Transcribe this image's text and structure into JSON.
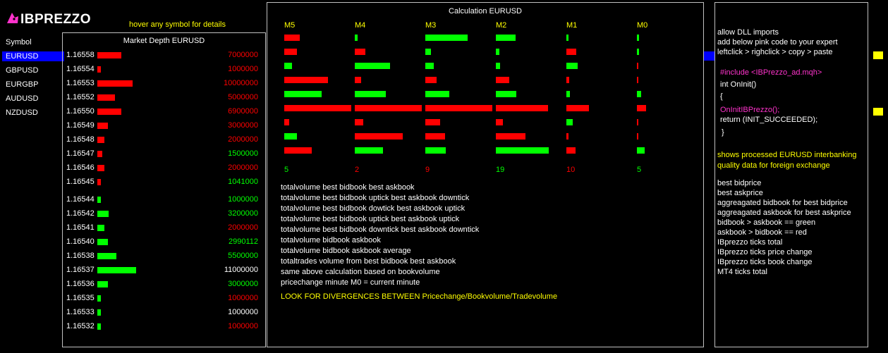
{
  "brand": {
    "name": "IBPREZZO"
  },
  "hint": "hover any symbol for details",
  "symbols": {
    "header": "Symbol",
    "items": [
      "EURUSD",
      "GBPUSD",
      "EURGBP",
      "AUDUSD",
      "NZDUSD"
    ],
    "active": "EURUSD"
  },
  "depth": {
    "title": "Market Depth EURUSD",
    "rows": [
      {
        "price": "1.16558",
        "volume": "7000000",
        "side": "ask",
        "size": 0.55
      },
      {
        "price": "1.16554",
        "volume": "1000000",
        "side": "ask",
        "size": 0.08
      },
      {
        "price": "1.16553",
        "volume": "10000000",
        "side": "ask",
        "size": 0.8
      },
      {
        "price": "1.16552",
        "volume": "5000000",
        "side": "ask",
        "size": 0.4
      },
      {
        "price": "1.16550",
        "volume": "6900000",
        "side": "ask",
        "size": 0.55
      },
      {
        "price": "1.16549",
        "volume": "3000000",
        "side": "ask",
        "size": 0.24
      },
      {
        "price": "1.16548",
        "volume": "2000000",
        "side": "ask",
        "size": 0.16
      },
      {
        "price": "1.16547",
        "volume": "1500000",
        "side": "ask",
        "vcolor": "green",
        "size": 0.12
      },
      {
        "price": "1.16546",
        "volume": "2000000",
        "side": "ask",
        "size": 0.16
      },
      {
        "price": "1.16545",
        "volume": "1041000",
        "side": "ask",
        "vcolor": "green",
        "size": 0.08
      },
      {
        "price": "1.16544",
        "volume": "1000000",
        "side": "bid",
        "size": 0.08
      },
      {
        "price": "1.16542",
        "volume": "3200000",
        "side": "bid",
        "size": 0.26
      },
      {
        "price": "1.16541",
        "volume": "2000000",
        "side": "bid",
        "vcolor": "red",
        "size": 0.16
      },
      {
        "price": "1.16540",
        "volume": "2990112",
        "side": "bid",
        "size": 0.24
      },
      {
        "price": "1.16538",
        "volume": "5500000",
        "side": "bid",
        "size": 0.44
      },
      {
        "price": "1.16537",
        "volume": "11000000",
        "side": "bid",
        "vcolor": "white",
        "size": 0.88
      },
      {
        "price": "1.16536",
        "volume": "3000000",
        "side": "bid",
        "size": 0.24
      },
      {
        "price": "1.16535",
        "volume": "1000000",
        "side": "bid",
        "vcolor": "red",
        "size": 0.08
      },
      {
        "price": "1.16533",
        "volume": "1000000",
        "side": "bid",
        "vcolor": "white",
        "size": 0.08
      },
      {
        "price": "1.16532",
        "volume": "1000000",
        "side": "bid",
        "vcolor": "red",
        "size": 0.08
      }
    ]
  },
  "calc": {
    "title": "Calculation EURUSD",
    "columns": [
      "M5",
      "M4",
      "M3",
      "M2",
      "M1",
      "M0"
    ],
    "counts": [
      "5",
      "2",
      "9",
      "19",
      "10",
      "5"
    ],
    "bars": [
      [
        {
          "c": "red",
          "w": 0.23
        },
        {
          "c": "green",
          "w": 0.04
        },
        {
          "c": "green",
          "w": 0.62
        },
        {
          "c": "green",
          "w": 0.29
        },
        {
          "c": "green",
          "w": 0.03
        },
        {
          "c": "green",
          "w": 0.03
        }
      ],
      [
        {
          "c": "red",
          "w": 0.19
        },
        {
          "c": "red",
          "w": 0.15
        },
        {
          "c": "green",
          "w": 0.08
        },
        {
          "c": "green",
          "w": 0.05
        },
        {
          "c": "red",
          "w": 0.14
        },
        {
          "c": "green",
          "w": 0.03
        }
      ],
      [
        {
          "c": "green",
          "w": 0.11
        },
        {
          "c": "green",
          "w": 0.52
        },
        {
          "c": "green",
          "w": 0.12
        },
        {
          "c": "green",
          "w": 0.06
        },
        {
          "c": "green",
          "w": 0.16
        },
        {
          "c": "red",
          "w": 0.02
        }
      ],
      [
        {
          "c": "red",
          "w": 0.64
        },
        {
          "c": "red",
          "w": 0.09
        },
        {
          "c": "red",
          "w": 0.16
        },
        {
          "c": "red",
          "w": 0.2
        },
        {
          "c": "red",
          "w": 0.04
        },
        {
          "c": "red",
          "w": 0.02
        }
      ],
      [
        {
          "c": "green",
          "w": 0.55
        },
        {
          "c": "green",
          "w": 0.45
        },
        {
          "c": "green",
          "w": 0.35
        },
        {
          "c": "green",
          "w": 0.3
        },
        {
          "c": "green",
          "w": 0.05
        },
        {
          "c": "green",
          "w": 0.06
        }
      ],
      [
        {
          "c": "red",
          "w": 0.98
        },
        {
          "c": "red",
          "w": 0.98
        },
        {
          "c": "red",
          "w": 0.98
        },
        {
          "c": "red",
          "w": 0.76
        },
        {
          "c": "red",
          "w": 0.33
        },
        {
          "c": "red",
          "w": 0.13
        }
      ],
      [
        {
          "c": "red",
          "w": 0.07
        },
        {
          "c": "red",
          "w": 0.12
        },
        {
          "c": "red",
          "w": 0.22
        },
        {
          "c": "red",
          "w": 0.1
        },
        {
          "c": "green",
          "w": 0.09
        },
        {
          "c": "red",
          "w": 0.02
        }
      ],
      [
        {
          "c": "green",
          "w": 0.19
        },
        {
          "c": "red",
          "w": 0.7
        },
        {
          "c": "red",
          "w": 0.29
        },
        {
          "c": "red",
          "w": 0.43
        },
        {
          "c": "red",
          "w": 0.03
        },
        {
          "c": "red",
          "w": 0.02
        }
      ],
      [
        {
          "c": "red",
          "w": 0.4
        },
        {
          "c": "green",
          "w": 0.41
        },
        {
          "c": "green",
          "w": 0.3
        },
        {
          "c": "green",
          "w": 0.77
        },
        {
          "c": "red",
          "w": 0.13
        },
        {
          "c": "green",
          "w": 0.11
        }
      ]
    ],
    "count_colors": [
      "green",
      "red",
      "red",
      "green",
      "red",
      "green"
    ],
    "descriptions": [
      "totalvolume best bidbook best askbook",
      "totalvolume best bidbook uptick best askbook downtick",
      "totalvolume best bidbook dowtick best askbook uptick",
      "totalvolume best bidbook uptick best askbook uptick",
      "totalvolume best bidbook downtick best askbook downtick",
      "totalvolume bidbook askbook",
      "totalvolume bidbook askbook average",
      "totaltrades volume from best bidbook best askbook",
      "same above calculation based on bookvolume",
      "pricechange minute M0 = current minute"
    ],
    "divergence": "LOOK FOR DIVERGENCES BETWEEN Pricechange/Bookvolume/Tradevolume"
  },
  "info": {
    "intro": [
      "allow DLL imports",
      "add below pink code to your expert",
      "leftclick > righclick > copy > paste"
    ],
    "code": [
      {
        "t": "#include <IBPrezzo_ad.mqh>",
        "c": "pink",
        "x": 4
      },
      {
        "t": "int OnInit()",
        "c": "white",
        "x": 4
      },
      {
        "t": "{",
        "c": "white",
        "x": 4
      },
      {
        "t": "OnInitIBPrezzo();",
        "c": "pink",
        "x": 4
      },
      {
        "t": "return (INIT_SUCCEEDED);",
        "c": "white",
        "x": 4
      },
      {
        "t": "}",
        "c": "white",
        "x": 6
      }
    ],
    "shows": [
      "shows processed  EURUSD  interbanking",
      "quality data for foreign exchange"
    ],
    "legend": [
      "best bidprice",
      "best askprice",
      "aggreagated bidbook for best bidprice",
      "aggreagated askbook for best askprice",
      "bidbook > askbook == green",
      "askbook > bidbook == red",
      "IBprezzo ticks total",
      "IBprezzo ticks price change",
      "IBprezzo ticks book change",
      "MT4 ticks total"
    ]
  },
  "colors": {
    "red": "#ff0000",
    "green": "#00ff00",
    "yellow": "#ffff00",
    "pink": "#ff33cc",
    "blue": "#0000ff",
    "white": "#ffffff"
  }
}
